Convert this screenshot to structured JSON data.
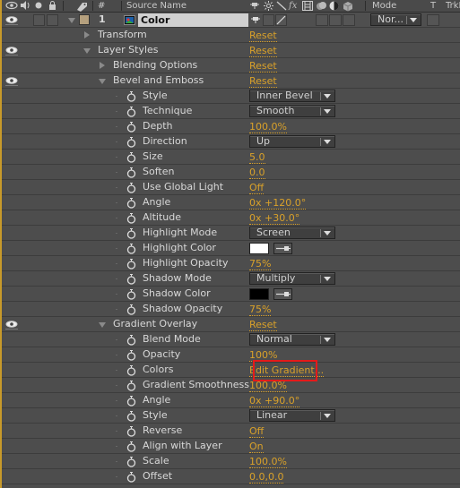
{
  "header": {
    "hash": "#",
    "source_name": "Source Name",
    "mode": "Mode",
    "t": "T",
    "trkmat": "TrkM"
  },
  "layer": {
    "number": "1",
    "name": "Color",
    "label_color": "#b5a07e",
    "mode": "Nor..."
  },
  "accent_color": "#d9a12a",
  "highlight_color": "#e41a1a",
  "rows": {
    "transform": {
      "label": "Transform",
      "value": "Reset"
    },
    "layer_styles": {
      "label": "Layer Styles",
      "value": "Reset"
    },
    "blending_options": {
      "label": "Blending Options",
      "value": "Reset"
    },
    "bevel_emboss": {
      "label": "Bevel and Emboss",
      "value": "Reset"
    },
    "bevel": {
      "style": {
        "label": "Style",
        "value": "Inner Bevel"
      },
      "technique": {
        "label": "Technique",
        "value": "Smooth"
      },
      "depth": {
        "label": "Depth",
        "value": "100.0%"
      },
      "direction": {
        "label": "Direction",
        "value": "Up"
      },
      "size": {
        "label": "Size",
        "value": "5.0"
      },
      "soften": {
        "label": "Soften",
        "value": "0.0"
      },
      "use_global_light": {
        "label": "Use Global Light",
        "value": "Off"
      },
      "angle": {
        "label": "Angle",
        "value": "0x +120.0°"
      },
      "altitude": {
        "label": "Altitude",
        "value": "0x +30.0°"
      },
      "highlight_mode": {
        "label": "Highlight Mode",
        "value": "Screen"
      },
      "highlight_color": {
        "label": "Highlight Color",
        "value": "#ffffff"
      },
      "highlight_opacity": {
        "label": "Highlight Opacity",
        "value": "75%"
      },
      "shadow_mode": {
        "label": "Shadow Mode",
        "value": "Multiply"
      },
      "shadow_color": {
        "label": "Shadow Color",
        "value": "#000000"
      },
      "shadow_opacity": {
        "label": "Shadow Opacity",
        "value": "75%"
      }
    },
    "gradient_overlay": {
      "label": "Gradient Overlay",
      "value": "Reset"
    },
    "gradient": {
      "blend_mode": {
        "label": "Blend Mode",
        "value": "Normal"
      },
      "opacity": {
        "label": "Opacity",
        "value": "100%"
      },
      "colors": {
        "label": "Colors",
        "value": "Edit Gradient..."
      },
      "gradient_smoothness": {
        "label": "Gradient Smoothness",
        "value": "100.0%"
      },
      "angle": {
        "label": "Angle",
        "value": "0x +90.0°"
      },
      "style": {
        "label": "Style",
        "value": "Linear"
      },
      "reverse": {
        "label": "Reverse",
        "value": "Off"
      },
      "align_with_layer": {
        "label": "Align with Layer",
        "value": "On"
      },
      "scale": {
        "label": "Scale",
        "value": "100.0%"
      },
      "offset": {
        "label": "Offset",
        "value": "0.0,0.0"
      }
    }
  }
}
